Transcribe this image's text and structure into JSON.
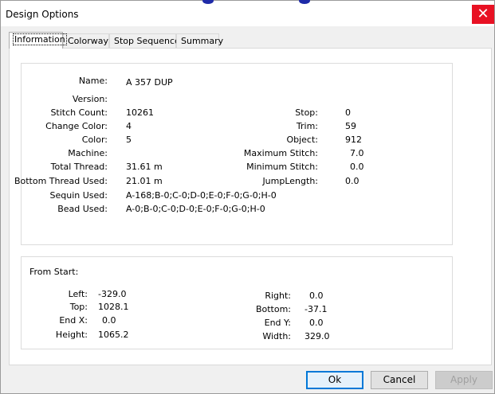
{
  "window": {
    "title": "Design Options",
    "close_glyph": "✕"
  },
  "tabs": [
    {
      "label": "Information"
    },
    {
      "label": "Colorway"
    },
    {
      "label": "Stop Sequence"
    },
    {
      "label": "Summary"
    }
  ],
  "info": {
    "name_label": "Name:",
    "name": "A 357 DUP",
    "version_label": "Version:",
    "version": "",
    "stitch_count_label": "Stitch Count:",
    "stitch_count": "10261",
    "change_color_label": "Change Color:",
    "change_color": "4",
    "color_label": "Color:",
    "color": "5",
    "machine_label": "Machine:",
    "machine": "",
    "total_thread_label": "Total Thread:",
    "total_thread": "31.61 m",
    "bottom_thread_label": "Bottom Thread Used:",
    "bottom_thread": "21.01 m",
    "sequin_label": "Sequin Used:",
    "sequin": "A-168;B-0;C-0;D-0;E-0;F-0;G-0;H-0",
    "bead_label": "Bead Used:",
    "bead": "A-0;B-0;C-0;D-0;E-0;F-0;G-0;H-0",
    "stop_label": "Stop:",
    "stop": "0",
    "trim_label": "Trim:",
    "trim": "59",
    "object_label": "Object:",
    "object": "912",
    "max_stitch_label": "Maximum Stitch:",
    "max_stitch": "7.0",
    "min_stitch_label": "Minimum Stitch:",
    "min_stitch": "0.0",
    "jump_length_label": "JumpLength:",
    "jump_length": "0.0"
  },
  "from_start": {
    "heading": "From Start:",
    "left_label": "Left:",
    "left": "-329.0",
    "top_label": "Top:",
    "top": "1028.1",
    "end_x_label": "End X:",
    "end_x": "0.0",
    "height_label": "Height:",
    "height": "1065.2",
    "right_label": "Right:",
    "right": "0.0",
    "bottom_label": "Bottom:",
    "bottom": "-37.1",
    "end_y_label": "End Y:",
    "end_y": "0.0",
    "width_label": "Width:",
    "width": "329.0"
  },
  "buttons": {
    "ok": "Ok",
    "cancel": "Cancel",
    "apply": "Apply"
  },
  "colors": {
    "close": "#e81123",
    "default_button_border": "#0078d7"
  }
}
